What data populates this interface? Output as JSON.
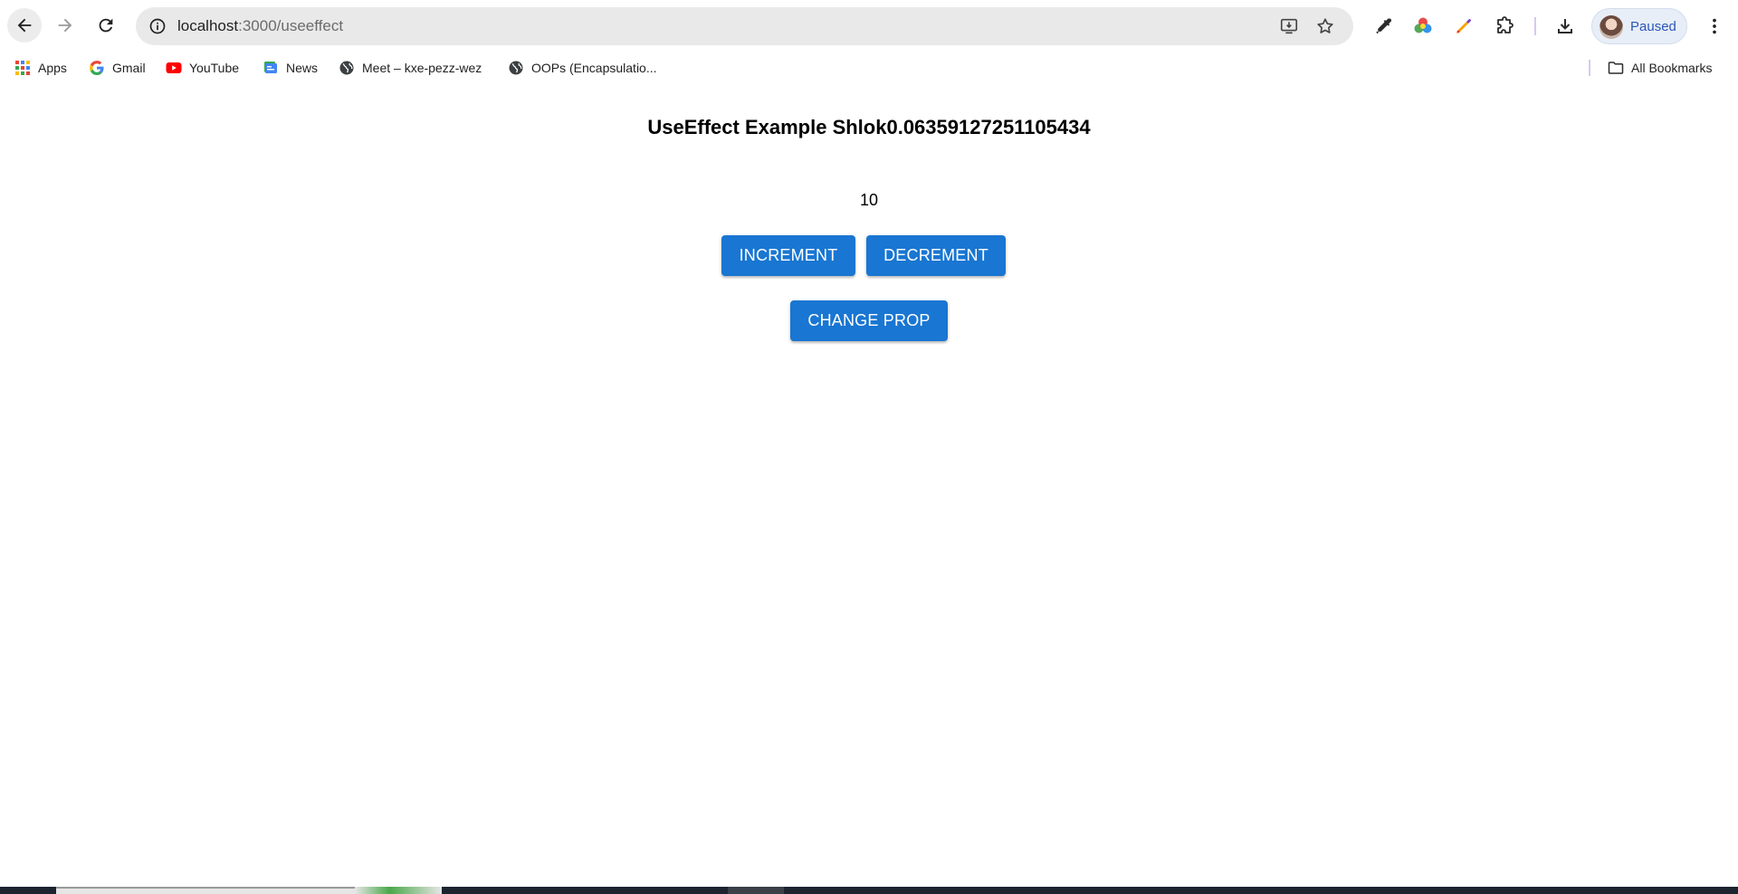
{
  "browser": {
    "url_host": "localhost",
    "url_path": ":3000/useeffect",
    "profile_label": "Paused"
  },
  "bookmarks": [
    {
      "label": "Apps"
    },
    {
      "label": "Gmail"
    },
    {
      "label": "YouTube"
    },
    {
      "label": "News"
    },
    {
      "label": "Meet – kxe-pezz-wez"
    },
    {
      "label": "OOPs (Encapsulatio..."
    }
  ],
  "all_bookmarks_label": "All Bookmarks",
  "page": {
    "title": "UseEffect Example Shlok0.06359127251105434",
    "counter": "10",
    "increment_label": "INCREMENT",
    "decrement_label": "DECREMENT",
    "change_prop_label": "CHANGE PROP"
  },
  "colors": {
    "primary_button": "#1976d2",
    "profile_text": "#2a56b8"
  }
}
